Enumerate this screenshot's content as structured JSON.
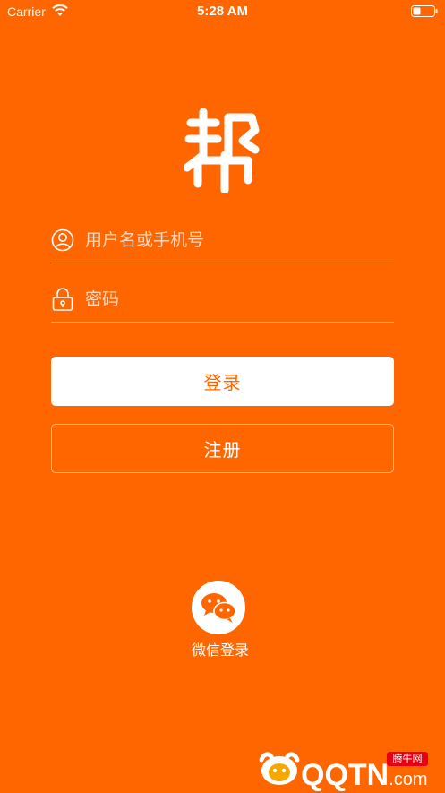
{
  "status_bar": {
    "carrier": "Carrier",
    "time": "5:28 AM"
  },
  "logo": {
    "text": "帮"
  },
  "login_form": {
    "username_placeholder": "用户名或手机号",
    "password_placeholder": "密码",
    "login_label": "登录",
    "register_label": "注册"
  },
  "wechat": {
    "label": "微信登录"
  },
  "watermark": {
    "site_text": "QQTN",
    "site_suffix": ".com",
    "badge_text": "腾牛网"
  },
  "colors": {
    "brand": "#ff6600",
    "text": "#ffffff"
  },
  "icons": [
    "wifi-icon",
    "battery-icon",
    "user-icon",
    "lock-icon",
    "wechat-icon"
  ]
}
